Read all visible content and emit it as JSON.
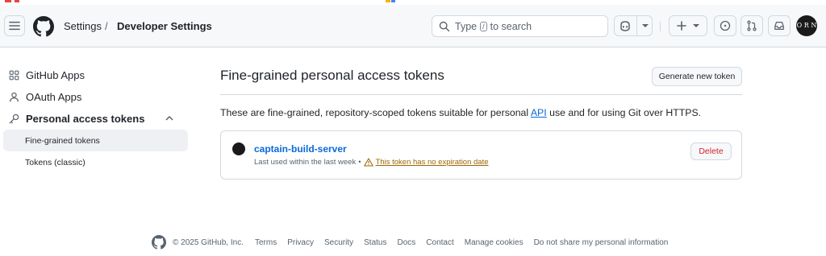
{
  "header": {
    "breadcrumb_settings": "Settings",
    "breadcrumb_separator": "/",
    "breadcrumb_developer": "Developer Settings",
    "search_prefix": "Type",
    "search_key": "/",
    "search_suffix": "to search",
    "avatar_text": "O R N",
    "icons": [
      "hamburger-icon",
      "github-logo",
      "search-icon",
      "copilot-icon",
      "chevron-down-icon",
      "plus-icon",
      "issues-icon",
      "pull-requests-icon",
      "inbox-icon"
    ]
  },
  "sidebar": {
    "items": [
      {
        "label": "GitHub Apps",
        "icon": "apps-icon"
      },
      {
        "label": "OAuth Apps",
        "icon": "person-icon"
      },
      {
        "label": "Personal access tokens",
        "icon": "key-icon"
      },
      {
        "label": "Fine-grained tokens"
      },
      {
        "label": "Tokens (classic)"
      }
    ]
  },
  "main": {
    "title": "Fine-grained personal access tokens",
    "generate_button": "Generate new token",
    "description_before": "These are fine-grained, repository-scoped tokens suitable for personal",
    "description_link": "API",
    "description_after": "use and for using Git over HTTPS.",
    "token": {
      "name": "captain-build-server",
      "last_used": "Last used within the last week",
      "bullet": "•",
      "warning": "This token has no expiration date",
      "delete_label": "Delete"
    }
  },
  "footer": {
    "copyright": "© 2025 GitHub, Inc.",
    "links": [
      "Terms",
      "Privacy",
      "Security",
      "Status",
      "Docs",
      "Contact",
      "Manage cookies",
      "Do not share my personal information"
    ]
  },
  "colors": {
    "accent": "#0969da",
    "danger": "#d1242f",
    "warning": "#9a6700",
    "muted": "#59636e",
    "border": "#d1d9e0"
  }
}
